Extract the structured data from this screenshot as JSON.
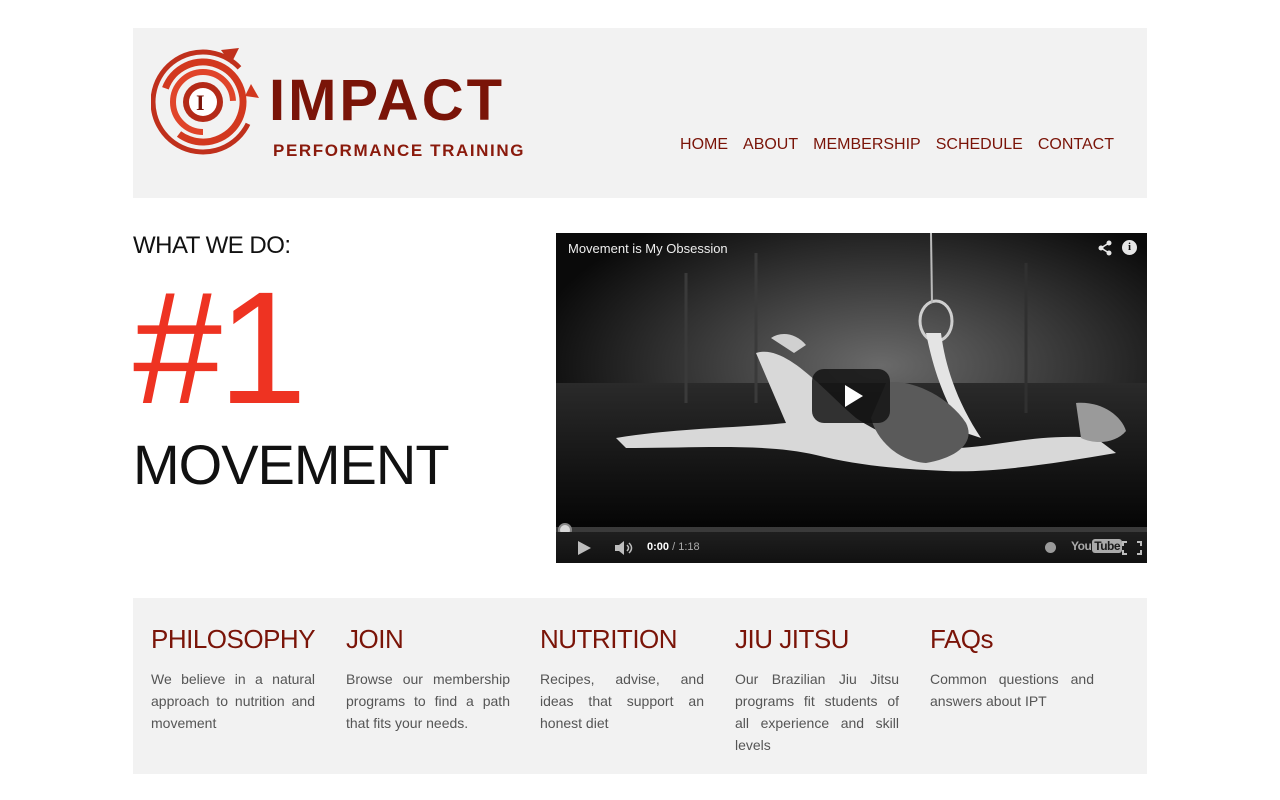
{
  "brand": {
    "logo_letter": "I",
    "name": "IMPACT",
    "tagline": "PERFORMANCE TRAINING",
    "colors": {
      "brand_red": "#7a1408",
      "accent_red": "#ee3322",
      "panel_bg": "#f2f2f2"
    }
  },
  "nav": {
    "items": [
      {
        "label": "HOME"
      },
      {
        "label": "ABOUT"
      },
      {
        "label": "MEMBERSHIP"
      },
      {
        "label": "SCHEDULE"
      },
      {
        "label": "CONTACT"
      }
    ]
  },
  "hero": {
    "kicker": "WHAT WE DO:",
    "rank": "#1",
    "headline": "MOVEMENT"
  },
  "video": {
    "title": "Movement is My Obsession",
    "current_time": "0:00",
    "duration": "1:18",
    "progress": 0,
    "provider_label": "You",
    "provider_label_boxed": "Tube",
    "icons": [
      "share-icon",
      "info-icon",
      "play-icon",
      "volume-icon",
      "watch-later-icon",
      "fullscreen-icon"
    ]
  },
  "features": [
    {
      "title": "PHILOSOPHY",
      "text": "We believe in a natural approach to nutrition and movement"
    },
    {
      "title": "JOIN",
      "text": "Browse our membership programs to find a path that fits your needs."
    },
    {
      "title": "NUTRITION",
      "text": "Recipes, advise, and ideas that support an honest diet"
    },
    {
      "title": "JIU JITSU",
      "text": "Our Brazilian Jiu Jitsu programs fit students of all experience and skill levels"
    },
    {
      "title": "FAQs",
      "text": "Common questions and answers about IPT"
    }
  ]
}
